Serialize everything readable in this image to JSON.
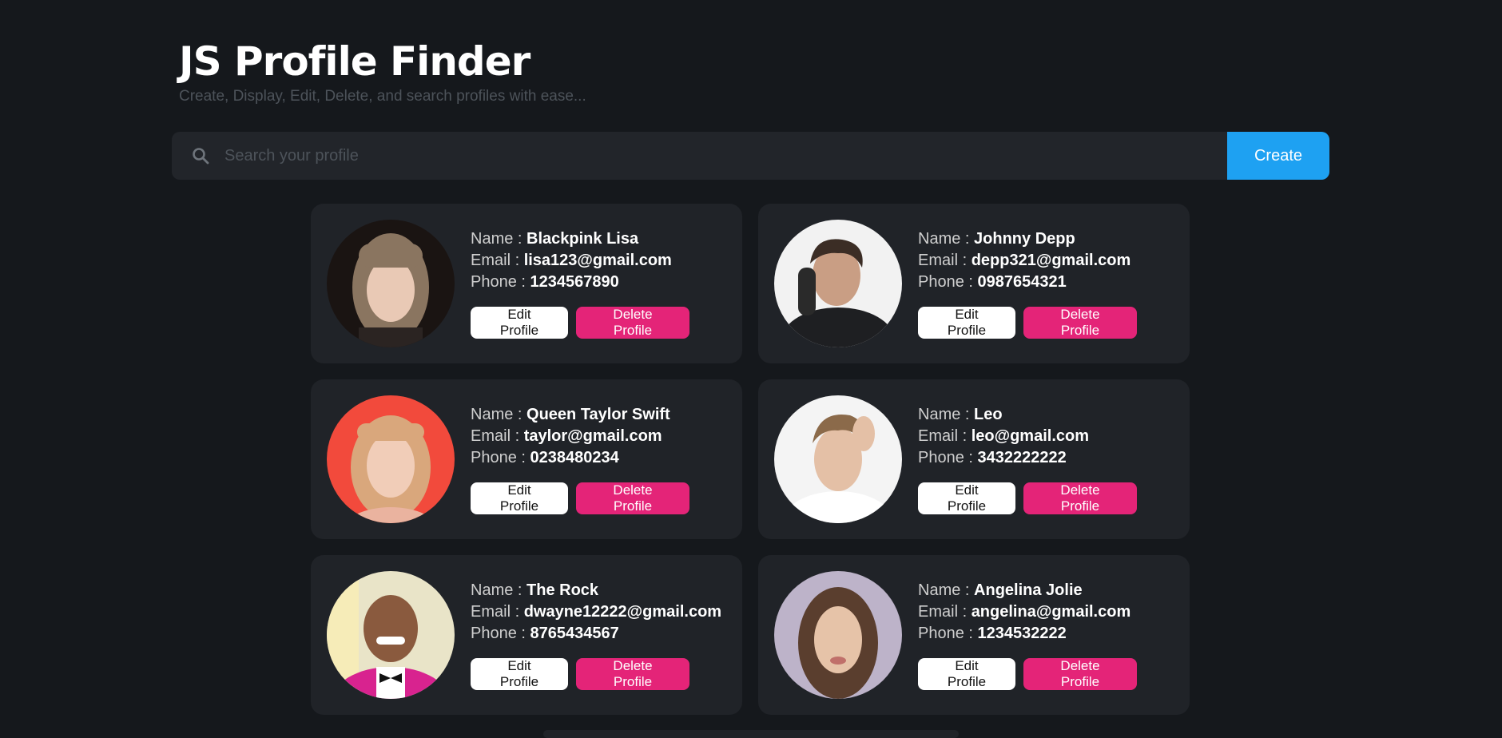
{
  "app": {
    "title": "JS Profile Finder",
    "subtitle": "Create, Display, Edit, Delete, and search profiles with ease..."
  },
  "search": {
    "placeholder": "Search your profile",
    "value": "",
    "icon": "search-icon",
    "create_label": "Create"
  },
  "labels": {
    "name": "Name : ",
    "email": "Email : ",
    "phone": "Phone : ",
    "edit": "Edit Profile",
    "delete": "Delete Profile"
  },
  "profiles": [
    {
      "name": "Blackpink Lisa",
      "email": "lisa123@gmail.com",
      "phone": "1234567890"
    },
    {
      "name": "Johnny Depp",
      "email": "depp321@gmail.com",
      "phone": "0987654321"
    },
    {
      "name": "Queen Taylor Swift",
      "email": "taylor@gmail.com",
      "phone": "0238480234"
    },
    {
      "name": "Leo",
      "email": "leo@gmail.com",
      "phone": "3432222222"
    },
    {
      "name": "The Rock",
      "email": "dwayne12222@gmail.com",
      "phone": "8765434567"
    },
    {
      "name": "Angelina Jolie",
      "email": "angelina@gmail.com",
      "phone": "1234532222"
    }
  ],
  "colors": {
    "background": "#15181c",
    "card": "#202328",
    "accent": "#1ea1f2",
    "danger": "#e42478"
  }
}
